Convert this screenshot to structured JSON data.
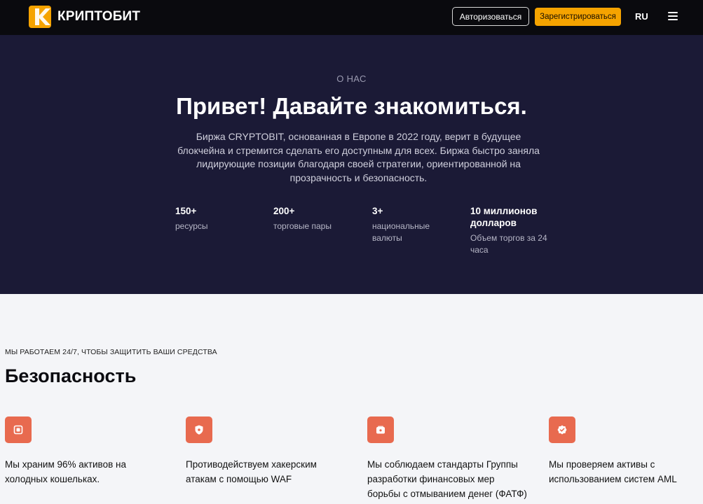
{
  "header": {
    "brand": "КРИПТОБИТ",
    "login_label": "Авторизоваться",
    "register_label": "Зарегистрироваться",
    "language": "RU",
    "accent_color": "#f5a300"
  },
  "hero": {
    "eyebrow": "О НАС",
    "title": "Привет! Давайте знакомиться.",
    "description": "Биржа CRYPTOBIT, основанная в Европе в 2022 году, верит в будущее блокчейна и стремится сделать его доступным для всех. Биржа быстро заняла лидирующие позиции благодаря своей стратегии, ориентированной на прозрачность и безопасность.",
    "stats": [
      {
        "value": "150+",
        "label": "ресурсы"
      },
      {
        "value": "200+",
        "label": "торговые пары"
      },
      {
        "value": "3+",
        "label": "национальные валюты"
      },
      {
        "value": "10 миллионов долларов",
        "label": "Объем торгов за 24 часа"
      }
    ]
  },
  "security": {
    "eyebrow": "МЫ РАБОТАЕМ 24/7, ЧТОБЫ ЗАЩИТИТЬ ВАШИ СРЕДСТВА",
    "title": "Безопасность",
    "features": [
      {
        "icon": "chip-icon",
        "text": "Мы храним 96% активов на холодных кошельках."
      },
      {
        "icon": "shield-icon",
        "text": "Противодействуем хакерским атакам с помощью WAF"
      },
      {
        "icon": "wallet-icon",
        "text": "Мы соблюдаем стандарты Группы разработки финансовых мер борьбы с отмыванием денег (ФАТФ)"
      },
      {
        "icon": "verified-badge-icon",
        "text": "Мы проверяем активы с использованием систем AML"
      }
    ],
    "icon_color": "#e86a4f"
  }
}
